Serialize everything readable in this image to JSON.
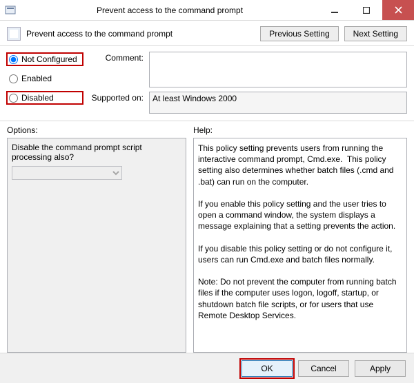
{
  "window": {
    "title": "Prevent access to the command prompt"
  },
  "header": {
    "policy_name": "Prevent access to the command prompt",
    "previous_btn": "Previous Setting",
    "next_btn": "Next Setting"
  },
  "state": {
    "not_configured": "Not Configured",
    "enabled": "Enabled",
    "disabled": "Disabled",
    "selected": "not_configured"
  },
  "fields": {
    "comment_label": "Comment:",
    "comment_value": "",
    "supported_label": "Supported on:",
    "supported_value": "At least Windows 2000"
  },
  "options": {
    "label": "Options:",
    "text": "Disable the command prompt script processing also?",
    "dropdown_value": "",
    "dropdown_disabled": true
  },
  "help": {
    "label": "Help:",
    "text": "This policy setting prevents users from running the interactive command prompt, Cmd.exe.  This policy setting also determines whether batch files (.cmd and .bat) can run on the computer.\n\nIf you enable this policy setting and the user tries to open a command window, the system displays a message explaining that a setting prevents the action.\n\nIf you disable this policy setting or do not configure it, users can run Cmd.exe and batch files normally.\n\nNote: Do not prevent the computer from running batch files if the computer uses logon, logoff, startup, or shutdown batch file scripts, or for users that use Remote Desktop Services."
  },
  "buttons": {
    "ok": "OK",
    "cancel": "Cancel",
    "apply": "Apply"
  }
}
